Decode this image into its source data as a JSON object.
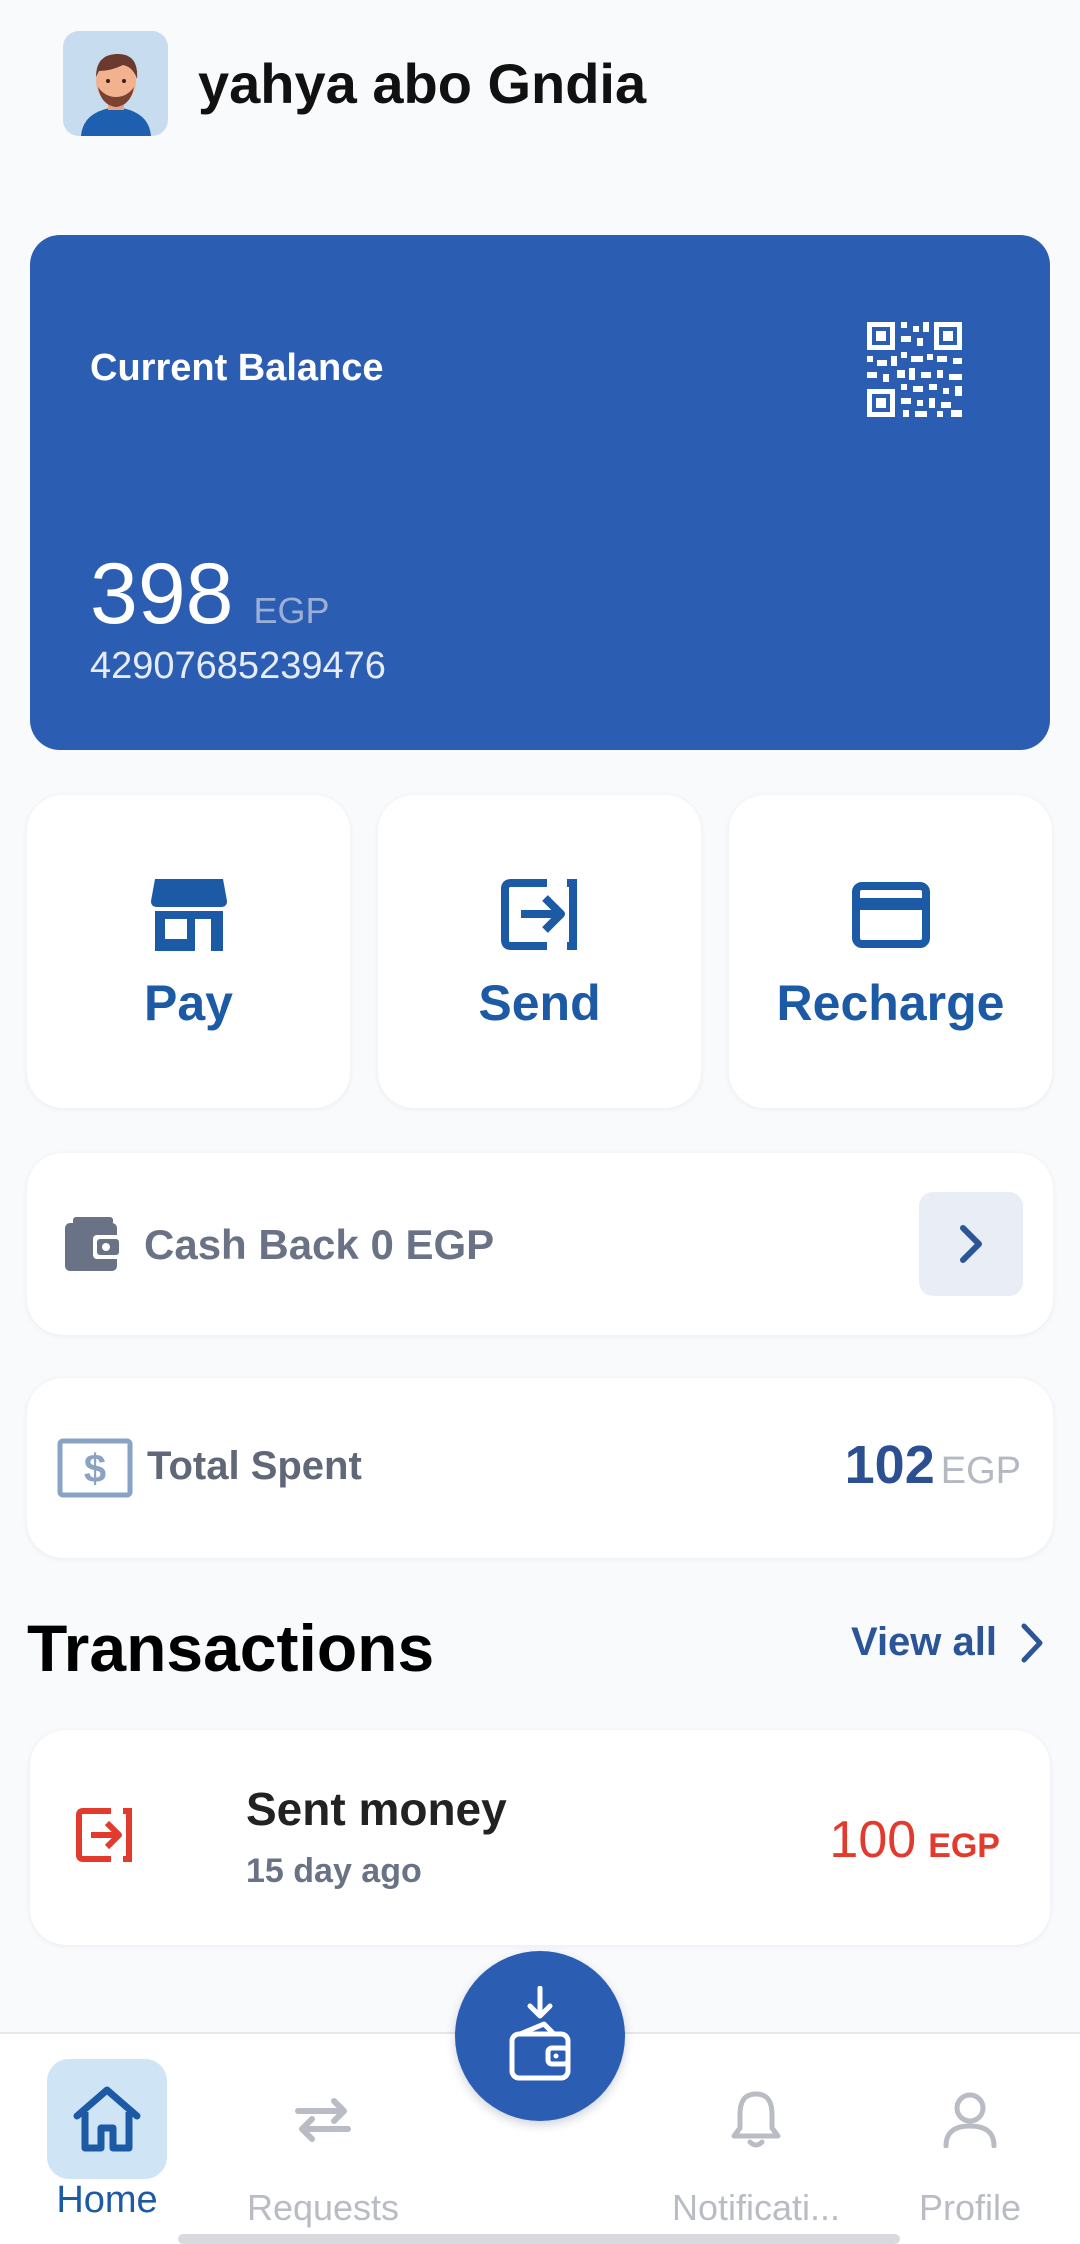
{
  "user": {
    "name": "yahya abo Gndia",
    "avatar_icon": "user-avatar-illustration"
  },
  "balance_card": {
    "title": "Current Balance",
    "amount": "398",
    "currency": "EGP",
    "account_number": "42907685239476",
    "qr_icon": "qr-code-icon",
    "color": "#2b5db3"
  },
  "actions": [
    {
      "label": "Pay",
      "icon": "store-icon"
    },
    {
      "label": "Send",
      "icon": "send-arrow-icon"
    },
    {
      "label": "Recharge",
      "icon": "credit-card-icon"
    }
  ],
  "cashback": {
    "label": "Cash Back 0 EGP",
    "icon": "wallet-icon",
    "arrow_icon": "chevron-right-icon"
  },
  "total_spent": {
    "label": "Total Spent",
    "value": "102",
    "currency": "EGP",
    "icon": "dollar-icon"
  },
  "transactions": {
    "title": "Transactions",
    "view_all": "View all",
    "items": [
      {
        "title": "Sent money",
        "time": "15 day ago",
        "amount": "100",
        "currency": "EGP",
        "icon": "send-arrow-icon",
        "color": "#e23a2c"
      }
    ]
  },
  "nav": {
    "items": [
      {
        "label": "Home",
        "icon": "home-icon",
        "active": true
      },
      {
        "label": "Requests",
        "icon": "swap-arrows-icon",
        "active": false
      },
      {
        "label": "Notificati...",
        "icon": "bell-icon",
        "active": false
      },
      {
        "label": "Profile",
        "icon": "person-icon",
        "active": false
      }
    ],
    "fab_icon": "wallet-download-icon"
  }
}
